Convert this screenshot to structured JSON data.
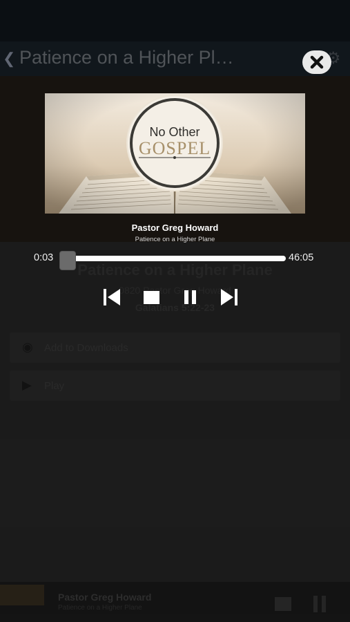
{
  "header": {
    "title": "Patience on a Higher Pl…"
  },
  "sermon": {
    "title": "Patience on a Higher Plane",
    "meta": "0820 Pastor Greg Howard",
    "scripture": "Galatians 5:22-23"
  },
  "actions": [
    {
      "label": "Add to Downloads",
      "icon": "eye-icon"
    },
    {
      "label": "Play",
      "icon": "play-icon"
    }
  ],
  "artwork": {
    "line1": "No Other",
    "line2": "GOSPEL"
  },
  "now_playing": {
    "artist": "Pastor Greg Howard",
    "title": "Patience on a Higher Plane",
    "elapsed": "0:03",
    "total": "46:05",
    "progress": 0.001
  },
  "mini_player": {
    "artist": "Pastor Greg Howard",
    "title": "Patience on a Higher Plane"
  },
  "colors": {
    "overlay_text": "#ffffff",
    "seek_track": "#ffffff",
    "seek_thumb": "#6b6b6b",
    "close_bg": "#e9e9e9"
  }
}
